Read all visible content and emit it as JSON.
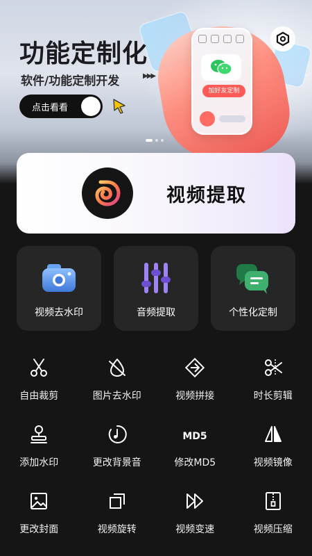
{
  "banner": {
    "title": "功能定制化",
    "subtitle": "软件/功能定制开发",
    "cta_label": "点击看看",
    "phone_cta": "加好友定制"
  },
  "hero": {
    "label": "视频提取"
  },
  "features": [
    {
      "label": "视频去水印",
      "icon": "camera-icon"
    },
    {
      "label": "音频提取",
      "icon": "equalizer-icon"
    },
    {
      "label": "个性化定制",
      "icon": "chat-bubbles-icon"
    }
  ],
  "tools": [
    {
      "label": "自由裁剪",
      "icon": "scissors-icon"
    },
    {
      "label": "图片去水印",
      "icon": "no-watermark-icon"
    },
    {
      "label": "视频拼接",
      "icon": "splice-icon"
    },
    {
      "label": "时长剪辑",
      "icon": "trim-icon"
    },
    {
      "label": "添加水印",
      "icon": "stamp-icon"
    },
    {
      "label": "更改背景音",
      "icon": "music-note-icon"
    },
    {
      "label": "修改MD5",
      "icon": "md5-icon"
    },
    {
      "label": "视频镜像",
      "icon": "mirror-icon"
    },
    {
      "label": "更改封面",
      "icon": "image-icon"
    },
    {
      "label": "视频旋转",
      "icon": "rotate-icon"
    },
    {
      "label": "视频变速",
      "icon": "fast-forward-icon"
    },
    {
      "label": "视频压缩",
      "icon": "compress-icon"
    }
  ],
  "md5_glyph": "MD5",
  "colors": {
    "background": "#151515",
    "card": "#262626",
    "accent_red": "#ff5a55",
    "accent_blue": "#5b8fe0",
    "accent_purple": "#8a6be0",
    "accent_green": "#3a9a63"
  }
}
